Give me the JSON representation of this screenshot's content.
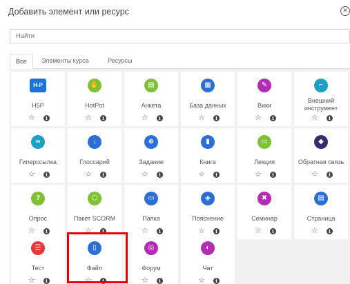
{
  "header": {
    "title": "Добавить элемент или ресурс",
    "close_icon": "close-icon"
  },
  "search": {
    "placeholder": "Найти"
  },
  "tabs": [
    {
      "label": "Все",
      "active": true
    },
    {
      "label": "Элементы курса",
      "active": false
    },
    {
      "label": "Ресурсы",
      "active": false
    }
  ],
  "items": [
    {
      "label": "H5P",
      "icon": "h5p-icon",
      "glyph": "H-P",
      "color": "#1a73d9"
    },
    {
      "label": "HotPot",
      "icon": "hotpot-icon",
      "glyph": "✋",
      "color": "#7ec234"
    },
    {
      "label": "Анкета",
      "icon": "survey-icon",
      "glyph": "▤",
      "color": "#7ec234"
    },
    {
      "label": "База данных",
      "icon": "database-icon",
      "glyph": "▦",
      "color": "#2b6fd6"
    },
    {
      "label": "Вики",
      "icon": "wiki-icon",
      "glyph": "✎",
      "color": "#b52bb3"
    },
    {
      "label": "Внешний инструмент",
      "icon": "external-tool-icon",
      "glyph": "⌐",
      "color": "#1aa2c6"
    },
    {
      "label": "Гиперссылка",
      "icon": "link-icon",
      "glyph": "∞",
      "color": "#1aa2c6"
    },
    {
      "label": "Глоссарий",
      "icon": "glossary-icon",
      "glyph": "↓",
      "color": "#2b6fd6"
    },
    {
      "label": "Задание",
      "icon": "assignment-icon",
      "glyph": "⊕",
      "color": "#2b6fd6"
    },
    {
      "label": "Книга",
      "icon": "book-icon",
      "glyph": "▮",
      "color": "#2b6fd6"
    },
    {
      "label": "Лекция",
      "icon": "lesson-icon",
      "glyph": "▭",
      "color": "#7ec234"
    },
    {
      "label": "Обратная связь",
      "icon": "feedback-icon",
      "glyph": "◆",
      "color": "#3a2d6b"
    },
    {
      "label": "Опрос",
      "icon": "choice-icon",
      "glyph": "?",
      "color": "#7ec234"
    },
    {
      "label": "Пакет SCORM",
      "icon": "scorm-icon",
      "glyph": "⬡",
      "color": "#7ec234"
    },
    {
      "label": "Папка",
      "icon": "folder-icon",
      "glyph": "▭",
      "color": "#2b6fd6"
    },
    {
      "label": "Пояснение",
      "icon": "label-icon",
      "glyph": "◈",
      "color": "#2b6fd6"
    },
    {
      "label": "Семинар",
      "icon": "workshop-icon",
      "glyph": "✖",
      "color": "#b52bb3"
    },
    {
      "label": "Страница",
      "icon": "page-icon",
      "glyph": "▤",
      "color": "#2b6fd6"
    },
    {
      "label": "Тест",
      "icon": "quiz-icon",
      "glyph": "☰",
      "color": "#e53a3a"
    },
    {
      "label": "Файл",
      "icon": "file-icon",
      "glyph": "▯",
      "color": "#2b6fd6"
    },
    {
      "label": "Форум",
      "icon": "forum-icon",
      "glyph": "◎",
      "color": "#b52bb3"
    },
    {
      "label": "Чат",
      "icon": "chat-icon",
      "glyph": "◐",
      "color": "#b52bb3"
    }
  ],
  "actions": {
    "star_glyph": "☆",
    "info_glyph": "i"
  },
  "highlight_color": "#e30000"
}
